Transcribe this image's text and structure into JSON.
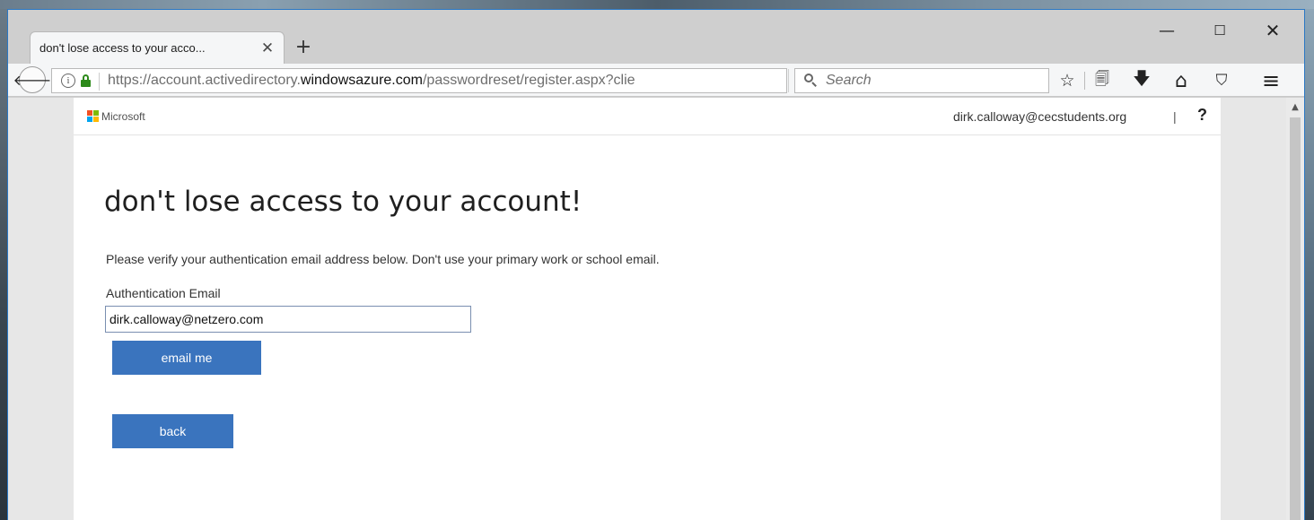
{
  "browser": {
    "tab_title": "don't lose access to your acco...",
    "tab_close": "✕",
    "new_tab": "+",
    "window_controls": {
      "minimize": "—",
      "maximize": "☐",
      "close": "✕"
    },
    "back_arrow": "🡐",
    "info_glyph": "i",
    "url_prefix": "https://account.activedirectory.",
    "url_domain": "windowsazure.com",
    "url_suffix": "/passwordreset/register.aspx?clie",
    "reload_glyph": "↻",
    "search_placeholder": "Search",
    "toolbar_icons": [
      "star-icon",
      "reading-list-icon",
      "download-icon",
      "home-icon",
      "pocket-icon",
      "menu-icon"
    ],
    "toolbar_glyphs": {
      "star": "☆",
      "reading_list": "🗐",
      "download": "🡇",
      "home": "⌂",
      "pocket": "⛉",
      "menu": "≡"
    },
    "scroll_up_glyph": "▲"
  },
  "page": {
    "brand": "Microsoft",
    "user_email": "dirk.calloway@cecstudents.org",
    "header_separator": "|",
    "help": "?",
    "title": "don't lose access to your account!",
    "instruction": "Please verify your authentication email address below. Don't use your primary work or school email.",
    "field_label": "Authentication Email",
    "email_value": "dirk.calloway@netzero.com",
    "email_me_label": "email me",
    "back_label": "back"
  },
  "colors": {
    "button_blue": "#3a74be",
    "lock_green": "#2d8a1a",
    "ms_red": "#f25022",
    "ms_green": "#7fba00",
    "ms_blue": "#00a4ef",
    "ms_yellow": "#ffb900"
  }
}
